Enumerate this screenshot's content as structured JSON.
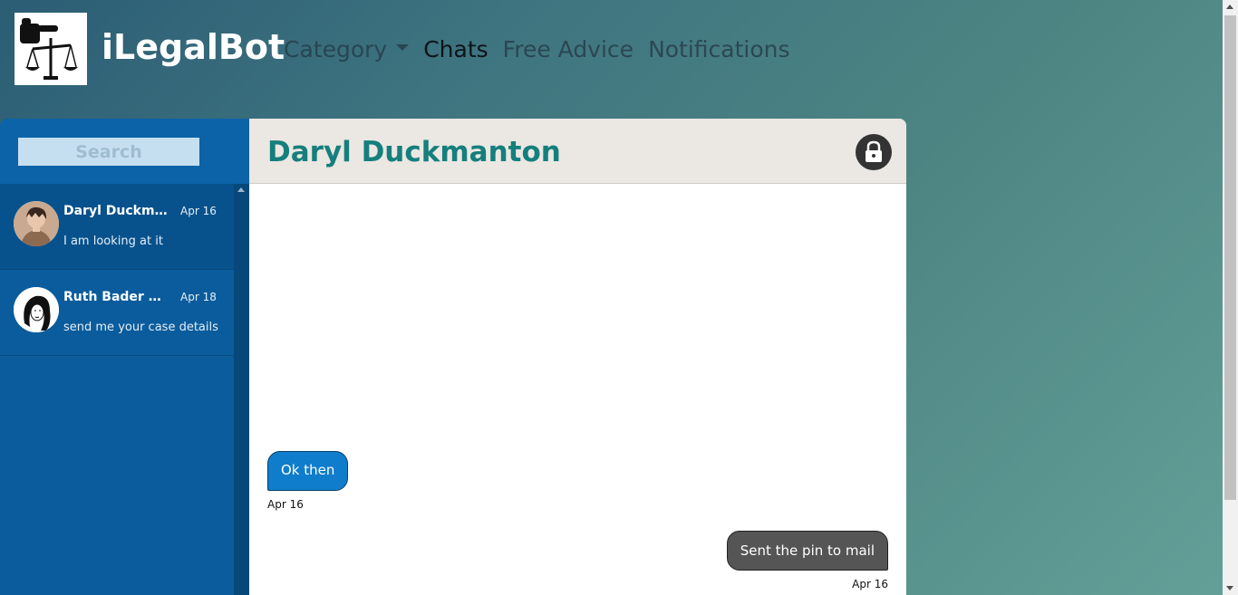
{
  "brand": {
    "name": "iLegalBot",
    "logo_icon": "pointing-hand-scales-icon"
  },
  "nav": {
    "category": "Category",
    "chats": "Chats",
    "free_advice": "Free Advice",
    "notifications": "Notifications"
  },
  "sidebar": {
    "search_placeholder": "Search",
    "chats": [
      {
        "name": "Daryl Duckma...",
        "date": "Apr 16",
        "preview": "I am looking at it",
        "selected": true
      },
      {
        "name": "Ruth Bader Gi...",
        "date": "Apr 18",
        "preview": "send me your case details",
        "selected": false
      }
    ]
  },
  "conversation": {
    "contact_name": "Daryl Duckmanton",
    "lock_icon": "lock-icon",
    "messages": [
      {
        "direction": "incoming",
        "text": "Ok then",
        "date": "Apr 16"
      },
      {
        "direction": "outgoing",
        "text": "Sent the pin to mail",
        "date": "Apr 16"
      }
    ]
  },
  "colors": {
    "sidebar": "#0a5c9c",
    "contact_name": "#157f7d",
    "incoming_bubble": "#0f7dcc",
    "outgoing_bubble": "#555555",
    "header_bg": "#ebe7e2"
  }
}
